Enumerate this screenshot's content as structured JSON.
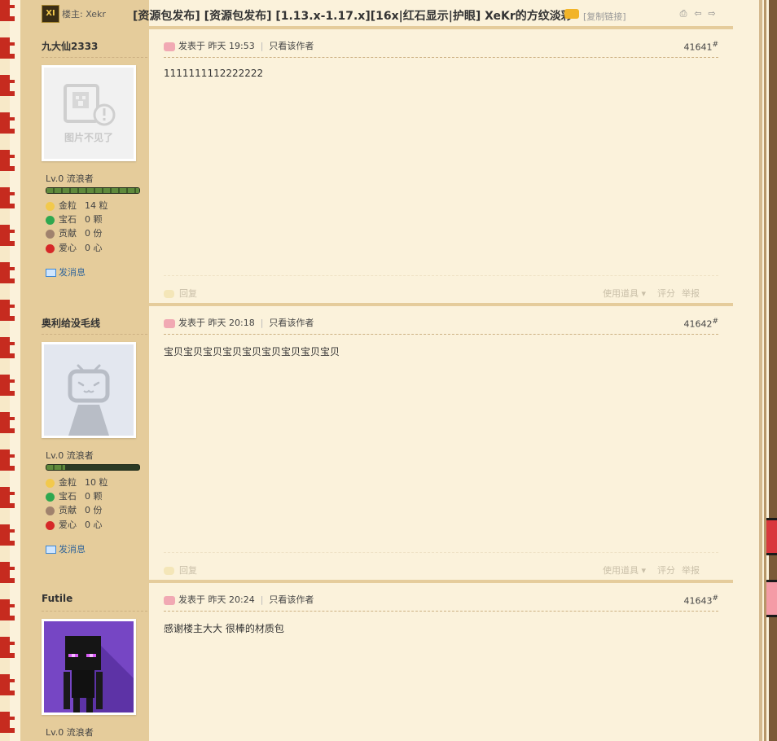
{
  "header": {
    "starter_icon_text": "XI",
    "starter_label": "楼主: Xekr",
    "title": "[资源包发布] [资源包发布] [1.13.x-1.17.x][16x|红石显示|护眼] XeKr的方纹淡彩",
    "copy_link": "[复制链接]",
    "print_icon": "⎙",
    "prev_icon": "⇦",
    "next_icon": "⇨"
  },
  "stat_labels": {
    "gold": "金粒",
    "gem": "宝石",
    "contrib": "贡献",
    "love": "爱心"
  },
  "send_message": "发消息",
  "reply_label": "回复",
  "tools_label": "使用道具",
  "rate_label": "评分",
  "report_label": "举报",
  "colors": {
    "accent_bg": "#e5cc9b",
    "page_bg": "#fbf2db",
    "link": "#336699"
  },
  "posts": [
    {
      "author": "九大仙2333",
      "avatar_text": "图片不见了",
      "level": "Lv.0 流浪者",
      "level_progress": 1.0,
      "gold": "14 粒",
      "gem": "0 颗",
      "contrib": "0 份",
      "love": "0 心",
      "posted": "发表于 昨天 19:53",
      "only_author": "只看该作者",
      "floor": "41641",
      "content": "1111111112222222"
    },
    {
      "author": "奥利给没毛线",
      "level": "Lv.0 流浪者",
      "level_progress": 0.2,
      "gold": "10 粒",
      "gem": "0 颗",
      "contrib": "0 份",
      "love": "0 心",
      "posted": "发表于 昨天 20:18",
      "only_author": "只看该作者",
      "floor": "41642",
      "content": "宝贝宝贝宝贝宝贝宝贝宝贝宝贝宝贝宝贝"
    },
    {
      "author": "Futile",
      "level": "Lv.0 流浪者",
      "posted": "发表于 昨天 20:24",
      "only_author": "只看该作者",
      "floor": "41643",
      "content": "感谢楼主大大 很棒的材质包"
    }
  ]
}
